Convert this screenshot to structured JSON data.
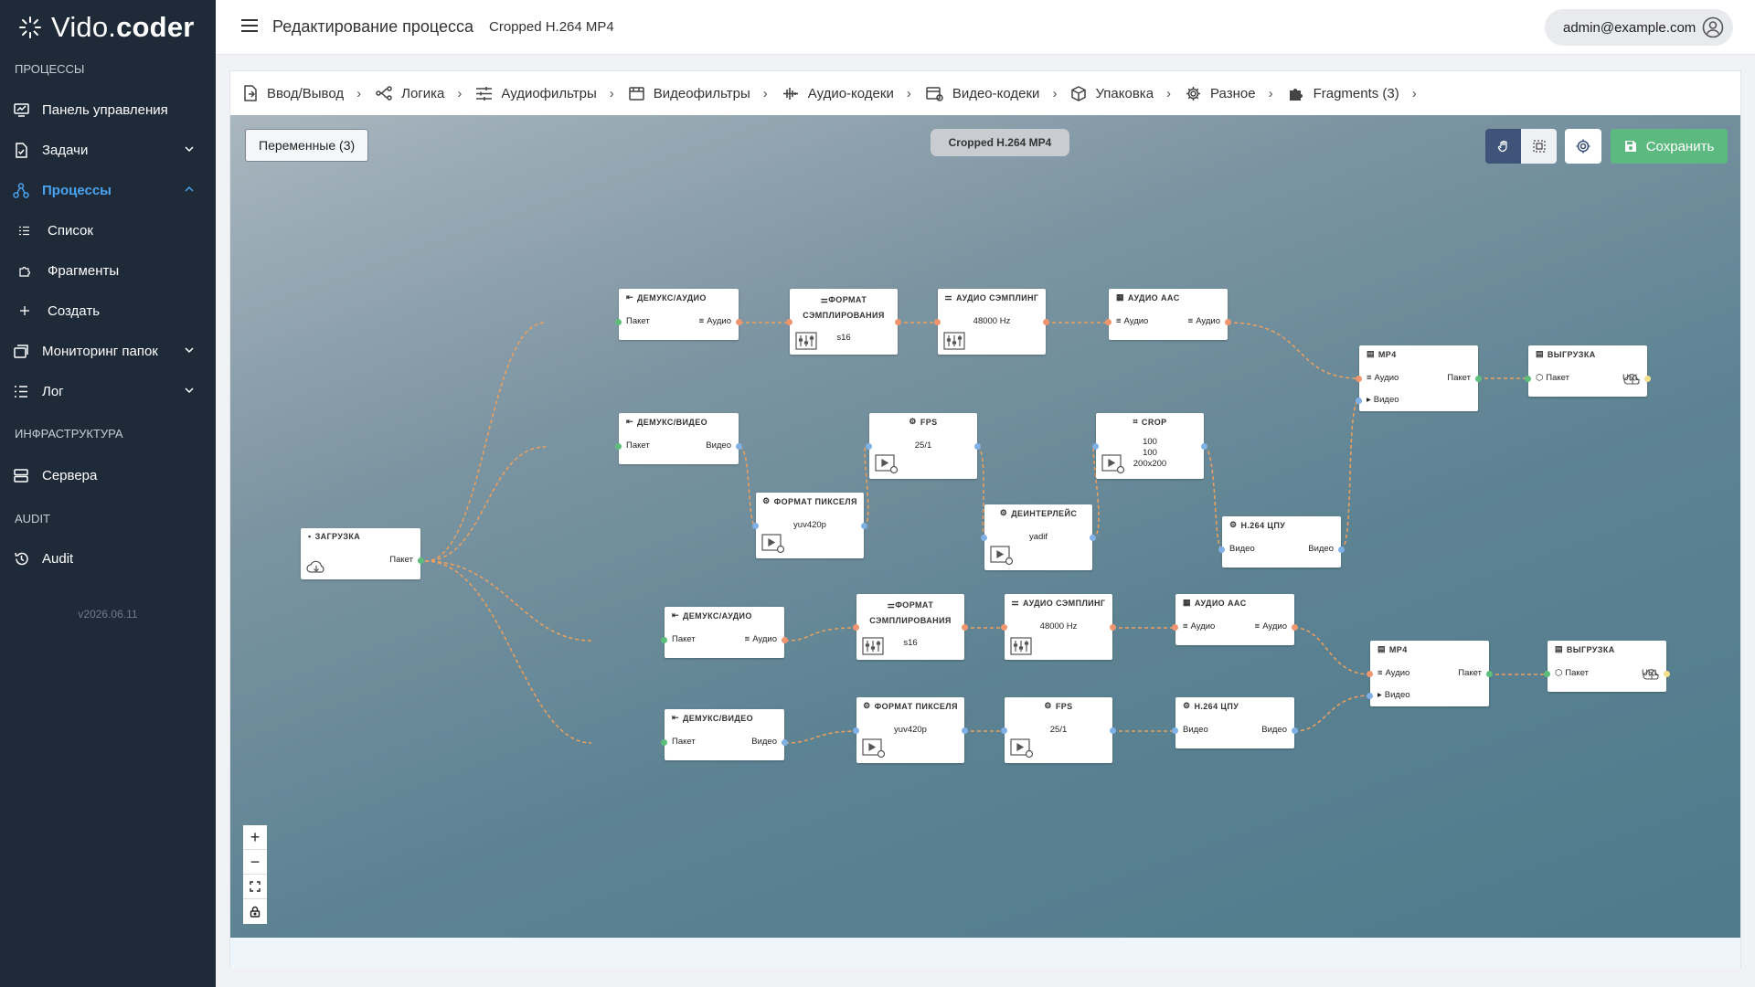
{
  "app": {
    "logo_part1": "Vido.",
    "logo_part2": "coder",
    "version": "v2026.06.11"
  },
  "sidebar": {
    "sections": {
      "processes": "ПРОЦЕССЫ",
      "infra": "ИНФРАСТРУКТУРА",
      "audit": "AUDIT"
    },
    "items": [
      {
        "label": "Панель управления",
        "icon": "dashboard-icon"
      },
      {
        "label": "Задачи",
        "icon": "tasks-icon",
        "chevron": "chevron-down"
      },
      {
        "label": "Процессы",
        "icon": "processes-icon",
        "chevron": "chevron-up",
        "active": true
      },
      {
        "label": "Список",
        "icon": "list-icon"
      },
      {
        "label": "Фрагменты",
        "icon": "puzzle-icon"
      },
      {
        "label": "Создать",
        "icon": "plus-icon"
      },
      {
        "label": "Мониторинг папок",
        "icon": "folders-icon",
        "chevron": "chevron-down"
      },
      {
        "label": "Лог",
        "icon": "log-icon",
        "chevron": "chevron-down"
      },
      {
        "label": "Сервера",
        "icon": "server-icon"
      },
      {
        "label": "Audit",
        "icon": "history-icon"
      }
    ]
  },
  "header": {
    "title": "Редактирование процесса",
    "subtitle": "Cropped H.264 MP4",
    "user": "admin@example.com"
  },
  "breadcrumbs": [
    {
      "label": "Ввод/Вывод",
      "icon": "io-icon"
    },
    {
      "label": "Логика",
      "icon": "logic-icon"
    },
    {
      "label": "Аудиофильтры",
      "icon": "sliders-icon"
    },
    {
      "label": "Видеофильтры",
      "icon": "video-filter-icon"
    },
    {
      "label": "Аудио-кодеки",
      "icon": "waveform-icon"
    },
    {
      "label": "Видео-кодеки",
      "icon": "video-codec-icon"
    },
    {
      "label": "Упаковка",
      "icon": "box-icon"
    },
    {
      "label": "Разное",
      "icon": "gear-icon"
    },
    {
      "label": "Fragments (3)",
      "icon": "puzzle-icon"
    }
  ],
  "toolbar": {
    "variables": "Переменные (3)",
    "process_name": "Cropped H.264 MP4",
    "save": "Сохранить"
  },
  "colors": {
    "sidebar": "#1f2a38",
    "active": "#4aa3f0",
    "save": "#5cb980",
    "wire": "#f0a05a"
  },
  "labels": {
    "packet": "Пакет",
    "audio": "Аудио",
    "video": "Видео",
    "url": "URL"
  },
  "nodes": {
    "load": {
      "title": "ЗАГРУЗКА"
    },
    "demux_a1": {
      "title": "ДЕМУКС/АУДИО"
    },
    "demux_v1": {
      "title": "ДЕМУКС/ВИДЕО"
    },
    "sfmt1": {
      "title": "ФОРМАТ СЭМПЛИРОВАНИЯ",
      "value": "s16"
    },
    "asamp1": {
      "title": "АУДИО СЭМПЛИНГ",
      "value": "48000 Hz"
    },
    "aac1": {
      "title": "АУДИО AAC"
    },
    "mp4_1": {
      "title": "MP4"
    },
    "up1": {
      "title": "ВЫГРУЗКА"
    },
    "fps1": {
      "title": "FPS",
      "value": "25/1"
    },
    "crop": {
      "title": "CROP",
      "line1": "100",
      "line2": "100",
      "line3": "200x200"
    },
    "pix1": {
      "title": "ФОРМАТ ПИКСЕЛЯ",
      "value": "yuv420p"
    },
    "deint": {
      "title": "ДЕИНТЕРЛЕЙС",
      "value": "yadif"
    },
    "h264_1": {
      "title": "H.264 ЦПУ"
    },
    "demux_a2": {
      "title": "ДЕМУКС/АУДИО"
    },
    "sfmt2": {
      "title": "ФОРМАТ СЭМПЛИРОВАНИЯ",
      "value": "s16"
    },
    "asamp2": {
      "title": "АУДИО СЭМПЛИНГ",
      "value": "48000 Hz"
    },
    "aac2": {
      "title": "АУДИО AAC"
    },
    "mp4_2": {
      "title": "MP4"
    },
    "up2": {
      "title": "ВЫГРУЗКА"
    },
    "demux_v2": {
      "title": "ДЕМУКС/ВИДЕО"
    },
    "pix2": {
      "title": "ФОРМАТ ПИКСЕЛЯ",
      "value": "yuv420p"
    },
    "fps2": {
      "title": "FPS",
      "value": "25/1"
    },
    "h264_2": {
      "title": "H.264 ЦПУ"
    }
  }
}
